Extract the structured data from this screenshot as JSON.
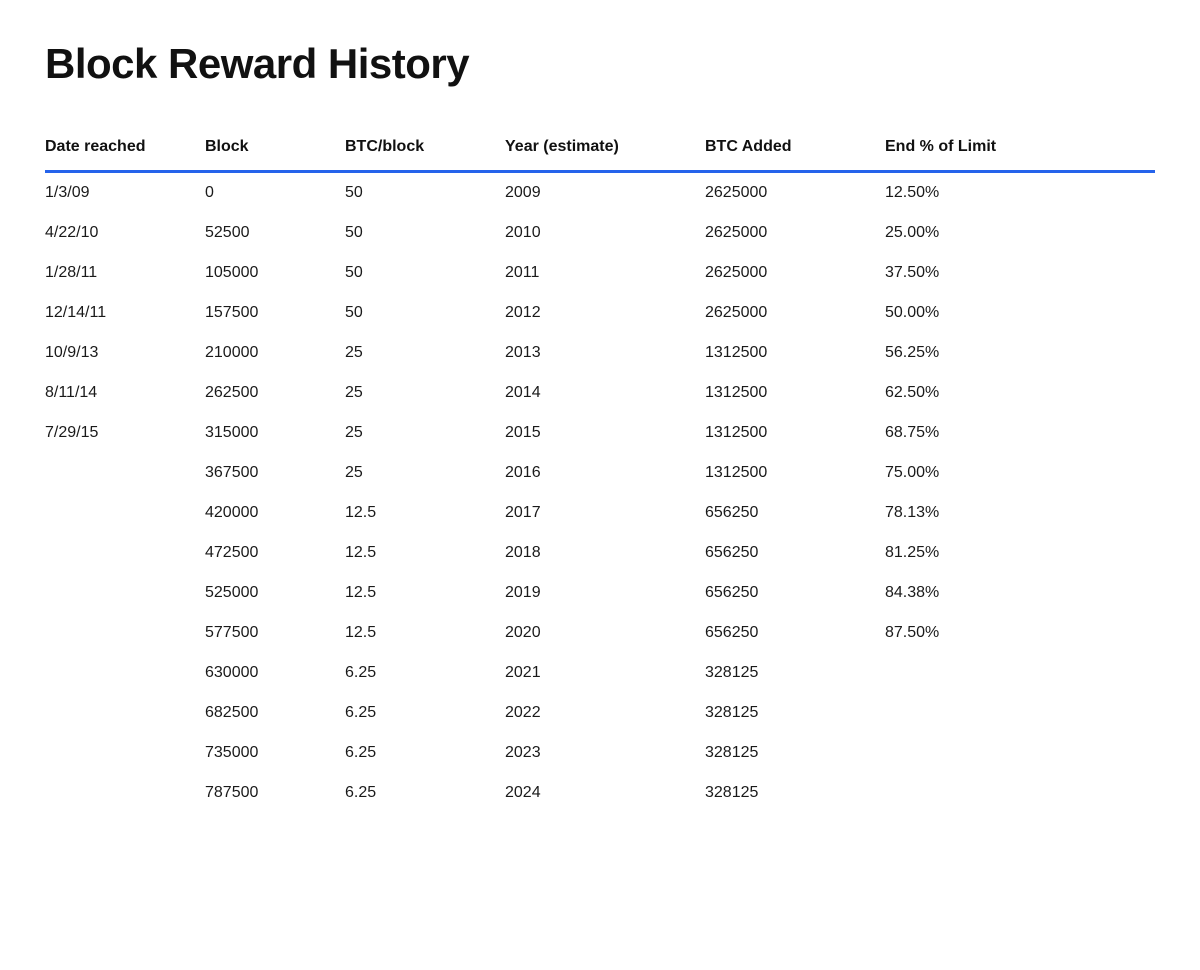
{
  "title": "Block Reward History",
  "columns": [
    {
      "key": "date",
      "label": "Date reached"
    },
    {
      "key": "block",
      "label": "Block"
    },
    {
      "key": "btcblock",
      "label": "BTC/block"
    },
    {
      "key": "year",
      "label": "Year (estimate)"
    },
    {
      "key": "btcadded",
      "label": "BTC Added"
    },
    {
      "key": "endlimit",
      "label": "End % of Limit"
    }
  ],
  "rows": [
    {
      "date": "1/3/09",
      "block": "0",
      "btcblock": "50",
      "year": "2009",
      "btcadded": "2625000",
      "endlimit": "12.50%"
    },
    {
      "date": "4/22/10",
      "block": "52500",
      "btcblock": "50",
      "year": "2010",
      "btcadded": "2625000",
      "endlimit": "25.00%"
    },
    {
      "date": "1/28/11",
      "block": "105000",
      "btcblock": "50",
      "year": "2011",
      "btcadded": "2625000",
      "endlimit": "37.50%"
    },
    {
      "date": "12/14/11",
      "block": "157500",
      "btcblock": "50",
      "year": "2012",
      "btcadded": "2625000",
      "endlimit": "50.00%"
    },
    {
      "date": "10/9/13",
      "block": "210000",
      "btcblock": "25",
      "year": "2013",
      "btcadded": "1312500",
      "endlimit": "56.25%"
    },
    {
      "date": "8/11/14",
      "block": "262500",
      "btcblock": "25",
      "year": "2014",
      "btcadded": "1312500",
      "endlimit": "62.50%"
    },
    {
      "date": "7/29/15",
      "block": "315000",
      "btcblock": "25",
      "year": "2015",
      "btcadded": "1312500",
      "endlimit": "68.75%"
    },
    {
      "date": "",
      "block": "367500",
      "btcblock": "25",
      "year": "2016",
      "btcadded": "1312500",
      "endlimit": "75.00%"
    },
    {
      "date": "",
      "block": "420000",
      "btcblock": "12.5",
      "year": "2017",
      "btcadded": "656250",
      "endlimit": "78.13%"
    },
    {
      "date": "",
      "block": "472500",
      "btcblock": "12.5",
      "year": "2018",
      "btcadded": "656250",
      "endlimit": "81.25%"
    },
    {
      "date": "",
      "block": "525000",
      "btcblock": "12.5",
      "year": "2019",
      "btcadded": "656250",
      "endlimit": "84.38%"
    },
    {
      "date": "",
      "block": "577500",
      "btcblock": "12.5",
      "year": "2020",
      "btcadded": "656250",
      "endlimit": "87.50%"
    },
    {
      "date": "",
      "block": "630000",
      "btcblock": "6.25",
      "year": "2021",
      "btcadded": "328125",
      "endlimit": ""
    },
    {
      "date": "",
      "block": "682500",
      "btcblock": "6.25",
      "year": "2022",
      "btcadded": "328125",
      "endlimit": ""
    },
    {
      "date": "",
      "block": "735000",
      "btcblock": "6.25",
      "year": "2023",
      "btcadded": "328125",
      "endlimit": ""
    },
    {
      "date": "",
      "block": "787500",
      "btcblock": "6.25",
      "year": "2024",
      "btcadded": "328125",
      "endlimit": ""
    }
  ]
}
